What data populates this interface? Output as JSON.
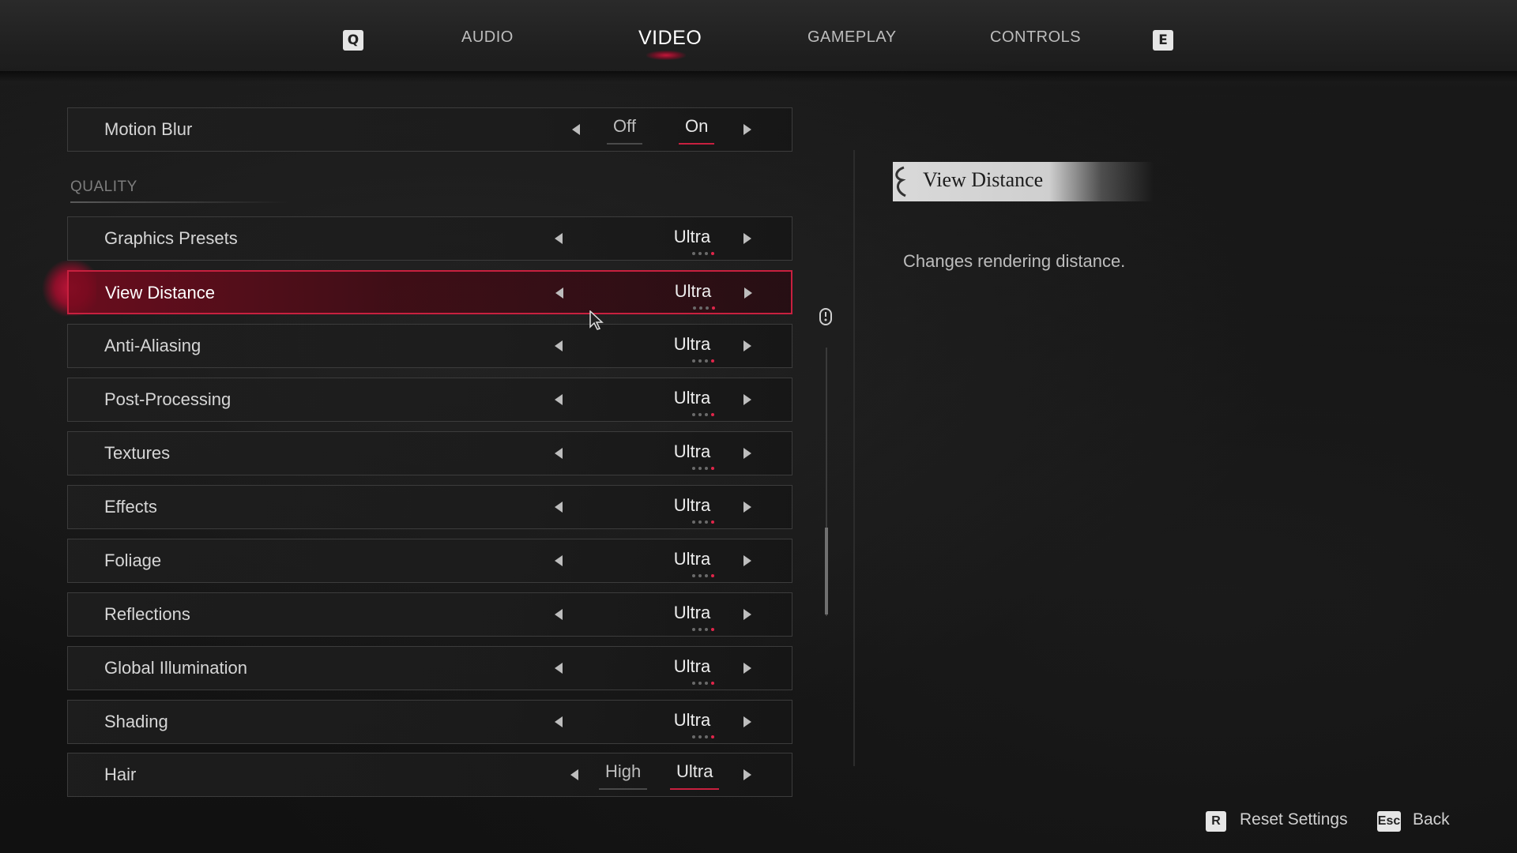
{
  "top_nav": {
    "prev_key": "Q",
    "next_key": "E",
    "tabs": [
      "AUDIO",
      "VIDEO",
      "GAMEPLAY",
      "CONTROLS"
    ],
    "active_tab": "VIDEO"
  },
  "motion_blur": {
    "label": "Motion Blur",
    "options": [
      "Off",
      "On"
    ],
    "selected": "On"
  },
  "section": {
    "title": "QUALITY"
  },
  "settings": [
    {
      "label": "Graphics Presets",
      "value": "Ultra"
    },
    {
      "label": "View Distance",
      "value": "Ultra"
    },
    {
      "label": "Anti-Aliasing",
      "value": "Ultra"
    },
    {
      "label": "Post-Processing",
      "value": "Ultra"
    },
    {
      "label": "Textures",
      "value": "Ultra"
    },
    {
      "label": "Effects",
      "value": "Ultra"
    },
    {
      "label": "Foliage",
      "value": "Ultra"
    },
    {
      "label": "Reflections",
      "value": "Ultra"
    },
    {
      "label": "Global Illumination",
      "value": "Ultra"
    },
    {
      "label": "Shading",
      "value": "Ultra"
    }
  ],
  "hair": {
    "label": "Hair",
    "options": [
      "High",
      "Ultra"
    ],
    "selected": "Ultra"
  },
  "description": {
    "title": "View Distance",
    "text": "Changes rendering distance."
  },
  "footer": {
    "reset_key": "R",
    "reset_label": "Reset Settings",
    "back_key": "Esc",
    "back_label": "Back"
  },
  "colors": {
    "accent": "#c8203f",
    "selected_row": "#78101e"
  },
  "icons": [
    "mouse-scroll-icon",
    "cursor-icon",
    "arrow-left-icon",
    "arrow-right-icon",
    "swirl-ornament-icon"
  ]
}
